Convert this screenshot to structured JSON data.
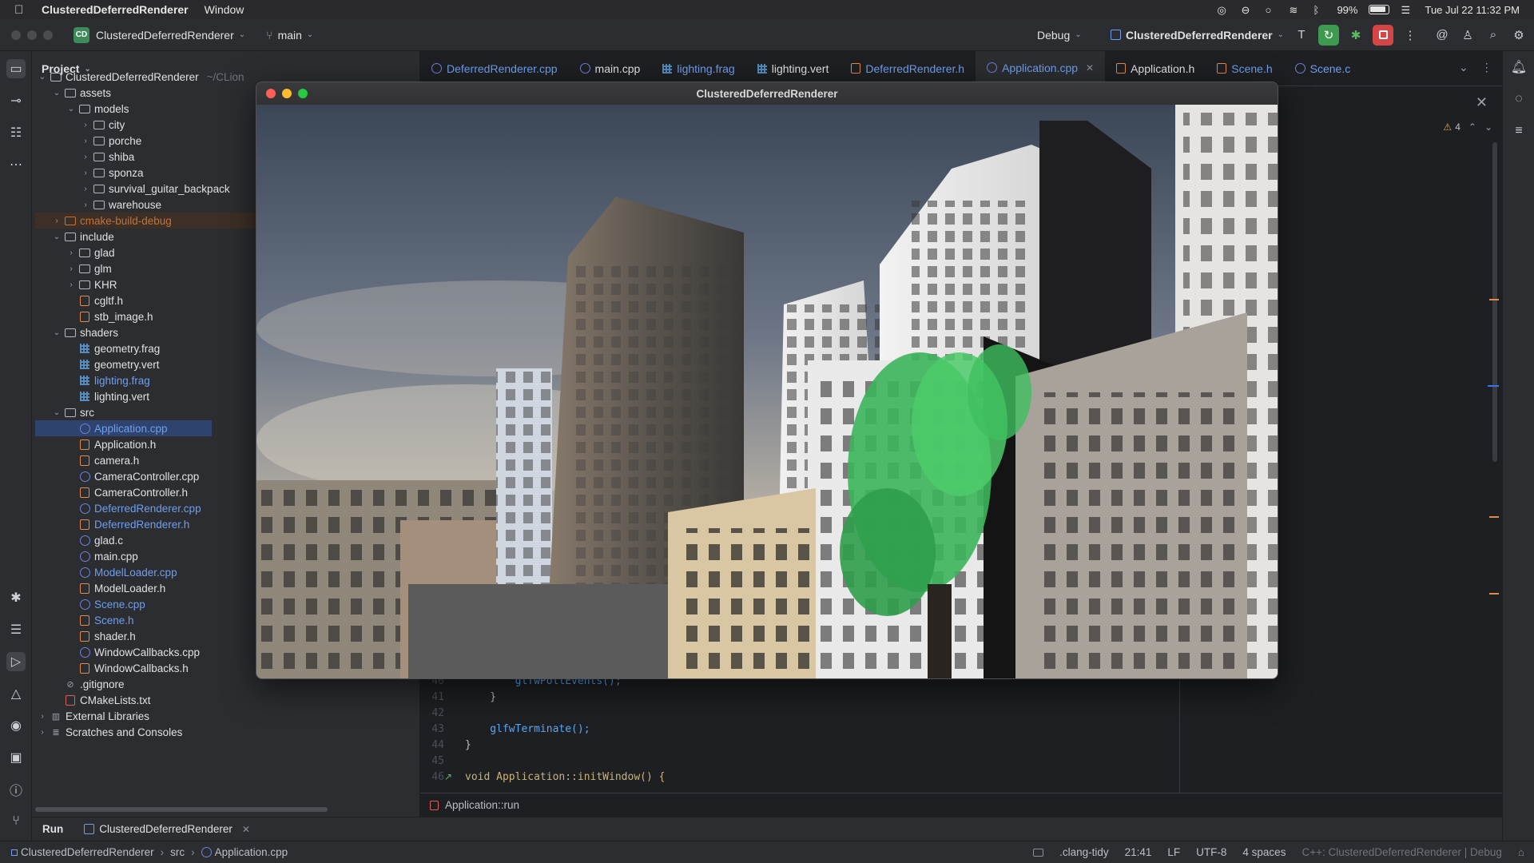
{
  "menubar": {
    "app_name": "ClusteredDeferredRenderer",
    "menu_window": "Window",
    "battery": "99%",
    "clock": "Tue Jul 22  11:32 PM"
  },
  "toolbar": {
    "project_badge": "CD",
    "project_name": "ClusteredDeferredRenderer",
    "branch": "main",
    "config": "Debug",
    "run_target": "ClusteredDeferredRenderer"
  },
  "project_panel": {
    "title": "Project",
    "tree": [
      {
        "label": "ClusteredDeferredRenderer",
        "suffix": "~/CLion",
        "depth": 0,
        "type": "folder",
        "open": true
      },
      {
        "label": "assets",
        "depth": 1,
        "type": "folder",
        "open": true
      },
      {
        "label": "models",
        "depth": 2,
        "type": "folder",
        "open": true
      },
      {
        "label": "city",
        "depth": 3,
        "type": "folder",
        "open": false
      },
      {
        "label": "porche",
        "depth": 3,
        "type": "folder",
        "open": false
      },
      {
        "label": "shiba",
        "depth": 3,
        "type": "folder",
        "open": false
      },
      {
        "label": "sponza",
        "depth": 3,
        "type": "folder",
        "open": false
      },
      {
        "label": "survival_guitar_backpack",
        "depth": 3,
        "type": "folder",
        "open": false
      },
      {
        "label": "warehouse",
        "depth": 3,
        "type": "folder",
        "open": false
      },
      {
        "label": "cmake-build-debug",
        "depth": 1,
        "type": "folder-excluded",
        "open": false
      },
      {
        "label": "include",
        "depth": 1,
        "type": "folder",
        "open": true
      },
      {
        "label": "glad",
        "depth": 2,
        "type": "folder",
        "open": false
      },
      {
        "label": "glm",
        "depth": 2,
        "type": "folder",
        "open": false
      },
      {
        "label": "KHR",
        "depth": 2,
        "type": "folder",
        "open": false
      },
      {
        "label": "cgltf.h",
        "depth": 2,
        "type": "h"
      },
      {
        "label": "stb_image.h",
        "depth": 2,
        "type": "h"
      },
      {
        "label": "shaders",
        "depth": 1,
        "type": "folder",
        "open": true
      },
      {
        "label": "geometry.frag",
        "depth": 2,
        "type": "glsl"
      },
      {
        "label": "geometry.vert",
        "depth": 2,
        "type": "glsl"
      },
      {
        "label": "lighting.frag",
        "depth": 2,
        "type": "glsl",
        "modified": true
      },
      {
        "label": "lighting.vert",
        "depth": 2,
        "type": "glsl"
      },
      {
        "label": "src",
        "depth": 1,
        "type": "folder",
        "open": true
      },
      {
        "label": "Application.cpp",
        "depth": 2,
        "type": "cpp",
        "modified": true,
        "selected": true
      },
      {
        "label": "Application.h",
        "depth": 2,
        "type": "h"
      },
      {
        "label": "camera.h",
        "depth": 2,
        "type": "h"
      },
      {
        "label": "CameraController.cpp",
        "depth": 2,
        "type": "cpp"
      },
      {
        "label": "CameraController.h",
        "depth": 2,
        "type": "h"
      },
      {
        "label": "DeferredRenderer.cpp",
        "depth": 2,
        "type": "cpp",
        "modified": true
      },
      {
        "label": "DeferredRenderer.h",
        "depth": 2,
        "type": "h",
        "modified": true
      },
      {
        "label": "glad.c",
        "depth": 2,
        "type": "cpp"
      },
      {
        "label": "main.cpp",
        "depth": 2,
        "type": "cpp"
      },
      {
        "label": "ModelLoader.cpp",
        "depth": 2,
        "type": "cpp",
        "modified": true
      },
      {
        "label": "ModelLoader.h",
        "depth": 2,
        "type": "h"
      },
      {
        "label": "Scene.cpp",
        "depth": 2,
        "type": "cpp",
        "modified": true
      },
      {
        "label": "Scene.h",
        "depth": 2,
        "type": "h",
        "modified": true
      },
      {
        "label": "shader.h",
        "depth": 2,
        "type": "h"
      },
      {
        "label": "WindowCallbacks.cpp",
        "depth": 2,
        "type": "cpp"
      },
      {
        "label": "WindowCallbacks.h",
        "depth": 2,
        "type": "h"
      },
      {
        "label": ".gitignore",
        "depth": 1,
        "type": "gitignore"
      },
      {
        "label": "CMakeLists.txt",
        "depth": 1,
        "type": "txt"
      },
      {
        "label": "External Libraries",
        "depth": 0,
        "type": "lib",
        "open": false
      },
      {
        "label": "Scratches and Consoles",
        "depth": 0,
        "type": "scratch",
        "open": false
      }
    ]
  },
  "tabs": [
    {
      "label": "DeferredRenderer.cpp",
      "type": "cpp",
      "modified": true
    },
    {
      "label": "main.cpp",
      "type": "cpp"
    },
    {
      "label": "lighting.frag",
      "type": "glsl",
      "modified": true
    },
    {
      "label": "lighting.vert",
      "type": "glsl"
    },
    {
      "label": "DeferredRenderer.h",
      "type": "h",
      "modified": true
    },
    {
      "label": "Application.cpp",
      "type": "cpp",
      "modified": true,
      "active": true
    },
    {
      "label": "Application.h",
      "type": "h"
    },
    {
      "label": "Scene.h",
      "type": "h",
      "modified": true
    },
    {
      "label": "Scene.c",
      "type": "cpp",
      "modified": true
    }
  ],
  "editor": {
    "warnings": "4",
    "lines": [
      {
        "n": "40",
        "code": "        glfwPollEvents();"
      },
      {
        "n": "41",
        "code": "    }"
      },
      {
        "n": "42",
        "code": ""
      },
      {
        "n": "43",
        "code": "    glfwTerminate();"
      },
      {
        "n": "44",
        "code": "}"
      },
      {
        "n": "45",
        "code": ""
      },
      {
        "n": "46",
        "code": "void Application::initWindow() {"
      }
    ],
    "breadcrumb": "Application::run"
  },
  "app_window": {
    "title": "ClusteredDeferredRenderer"
  },
  "runbar": {
    "run_label": "Run",
    "run_config": "ClusteredDeferredRenderer"
  },
  "statusbar": {
    "path": [
      "ClusteredDeferredRenderer",
      "src",
      "Application.cpp"
    ],
    "clang_tidy": ".clang-tidy",
    "position": "21:41",
    "line_ending": "LF",
    "encoding": "UTF-8",
    "indent": "4 spaces",
    "context": "C++: ClusteredDeferredRenderer | Debug"
  },
  "colors": {
    "accent": "#3574f0",
    "modified_file": "#6e9ff0",
    "run_green": "#3d9a50",
    "stop_red": "#d64545"
  }
}
